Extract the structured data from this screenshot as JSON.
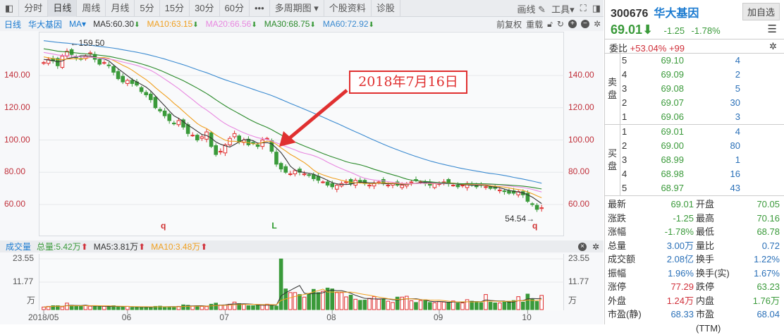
{
  "toolbar": {
    "tabs": [
      "分时",
      "日线",
      "周线",
      "月线",
      "5分",
      "15分",
      "30分",
      "60分",
      "•••",
      "多周期图 ▾",
      "个股资料",
      "诊股"
    ],
    "active": 1,
    "draw": "画线",
    "tools": "工具▾"
  },
  "mabar": {
    "period": "日线",
    "name": "华大基因",
    "ma": "MA▾",
    "ma5": "MA5:60.30",
    "ma10": "MA10:63.15",
    "ma20": "MA20:66.56",
    "ma30": "MA30:68.75",
    "ma60": "MA60:72.92",
    "down": "⬇",
    "adjust": "前复权",
    "reload": "重载"
  },
  "colors": {
    "up": "#e03030",
    "down": "#3a9a3a",
    "ma5": "#333333",
    "ma10": "#f0a020",
    "ma20": "#e888e0",
    "ma30": "#2a8a2a",
    "ma60": "#3a8ad0"
  },
  "volhdr": {
    "label": "成交量",
    "total": "总量:5.42万",
    "ma5": "MA5:3.81万",
    "ma10": "MA10:3.48万",
    "up": "⬆"
  },
  "annotation": {
    "text": "2018年7月16日"
  },
  "markers": [
    {
      "text": "q",
      "index": 25
    },
    {
      "text": "L",
      "index": 49
    },
    {
      "text": "q",
      "index": 105
    }
  ],
  "chart_data": {
    "type": "candlestick",
    "price_ticks": [
      60,
      80,
      100,
      120,
      140
    ],
    "price_range": [
      48,
      170
    ],
    "price_tick_labels": [
      "60.00",
      "80.00",
      "100.00",
      "120.00",
      "140.00"
    ],
    "high_label": "←159.50",
    "high_index": 6,
    "high_value": 159.5,
    "low_label": "54.54→",
    "low_index": 107,
    "low_value": 54.54,
    "vol_ticks": [
      "23.55",
      "11.77",
      "万"
    ],
    "vol_max": 23.55,
    "x_labels": [
      {
        "text": "2018/05",
        "index": 0
      },
      {
        "text": "06",
        "index": 18
      },
      {
        "text": "07",
        "index": 39
      },
      {
        "text": "08",
        "index": 62
      },
      {
        "text": "09",
        "index": 85
      },
      {
        "text": "10",
        "index": 104
      }
    ],
    "history_closes": [
      170,
      169,
      171,
      168,
      167,
      169,
      170,
      168,
      166,
      167,
      168,
      169,
      170,
      168,
      167,
      165,
      166,
      168,
      167,
      166,
      165,
      164,
      166,
      167,
      165,
      164,
      163,
      165,
      164,
      163,
      162,
      163,
      164,
      162,
      161,
      160,
      162,
      161,
      160,
      159,
      158,
      160,
      159,
      158,
      157,
      158,
      157,
      156,
      157,
      155,
      154,
      155,
      154,
      153,
      152,
      151,
      152,
      151,
      150,
      149
    ],
    "closes": [
      148,
      150,
      149,
      146,
      152,
      155,
      153,
      151,
      150,
      152,
      154,
      150,
      147,
      148,
      146,
      142,
      138,
      136,
      137,
      135,
      134,
      130,
      128,
      125,
      120,
      118,
      115,
      112,
      110,
      112,
      108,
      104,
      103,
      100,
      102,
      105,
      96,
      91,
      93,
      97,
      101,
      104,
      99,
      100,
      97,
      98,
      96,
      100,
      101,
      93,
      85,
      82,
      80,
      79,
      81,
      80,
      79,
      78,
      76,
      75,
      74,
      72,
      71,
      72,
      73,
      74,
      73,
      75,
      74,
      73,
      72,
      73,
      74,
      73,
      72,
      73,
      72,
      72,
      73,
      74,
      75,
      74,
      73,
      72,
      73,
      73,
      74,
      73,
      72,
      71,
      72,
      73,
      72,
      71,
      72,
      71,
      70,
      70,
      69,
      68,
      67,
      67,
      68,
      66,
      62,
      60,
      57,
      58
    ],
    "volumes": [
      1.2,
      1.5,
      1.8,
      1.8,
      1.3,
      3.0,
      2.0,
      1.5,
      1.7,
      2.0,
      1.6,
      1.6,
      1.3,
      1.5,
      1.4,
      1.8,
      1.4,
      1.2,
      1.5,
      1.0,
      1.2,
      1.2,
      1.1,
      1.3,
      1.5,
      1.6,
      1.3,
      1.3,
      1.3,
      1.5,
      2.2,
      2.0,
      1.6,
      1.7,
      1.5,
      1.4,
      2.5,
      3.0,
      2.1,
      2.1,
      2.5,
      3.5,
      2.8,
      2.5,
      1.8,
      1.8,
      2.0,
      2.1,
      2.5,
      2.0,
      1.6,
      23.5,
      9.6,
      7.9,
      7.9,
      7.0,
      5.8,
      7.5,
      9.4,
      7.9,
      8.5,
      10.0,
      9.6,
      7.9,
      7.9,
      5.9,
      6.7,
      4.8,
      4.3,
      4.4,
      5.2,
      6.0,
      4.8,
      4.8,
      3.9,
      3.3,
      5.8,
      5.8,
      6.2,
      4.1,
      3.3,
      4.2,
      4.5,
      3.3,
      3.2,
      3.7,
      3.5,
      3.2,
      4.0,
      3.1,
      3.1,
      4.6,
      3.9,
      3.7,
      3.2,
      7.0,
      3.4,
      3.1,
      3.1,
      3.5,
      3.8,
      4.2,
      6.0,
      3.5,
      7.2,
      4.8,
      3.8,
      6.6
    ]
  },
  "quote": {
    "code": "300676",
    "name": "华大基因",
    "add": "加自选",
    "last": "69.01",
    "arrow": "⬇",
    "chg": "-1.25",
    "pct": "-1.78%",
    "menu": "☰"
  },
  "weibi": {
    "label": "委比",
    "pct": "+53.04%",
    "diff": "+99"
  },
  "sell": {
    "label1": "卖",
    "label2": "盘",
    "rows": [
      {
        "l": "5",
        "p": "69.10",
        "v": "4"
      },
      {
        "l": "4",
        "p": "69.09",
        "v": "2"
      },
      {
        "l": "3",
        "p": "69.08",
        "v": "5"
      },
      {
        "l": "2",
        "p": "69.07",
        "v": "30"
      },
      {
        "l": "1",
        "p": "69.06",
        "v": "3"
      }
    ]
  },
  "buy": {
    "label1": "买",
    "label2": "盘",
    "rows": [
      {
        "l": "1",
        "p": "69.01",
        "v": "4"
      },
      {
        "l": "2",
        "p": "69.00",
        "v": "80"
      },
      {
        "l": "3",
        "p": "68.99",
        "v": "1"
      },
      {
        "l": "4",
        "p": "68.98",
        "v": "16"
      },
      {
        "l": "5",
        "p": "68.97",
        "v": "43"
      }
    ]
  },
  "stats": [
    {
      "k": "最新",
      "v": "69.01",
      "c": "g",
      "k2": "开盘",
      "v2": "70.05",
      "c2": "g"
    },
    {
      "k": "涨跌",
      "v": "-1.25",
      "c": "g",
      "k2": "最高",
      "v2": "70.16",
      "c2": "g"
    },
    {
      "k": "涨幅",
      "v": "-1.78%",
      "c": "g",
      "k2": "最低",
      "v2": "68.78",
      "c2": "g"
    },
    {
      "k": "总量",
      "v": "3.00万",
      "c": "b",
      "k2": "量比",
      "v2": "0.72",
      "c2": "b"
    },
    {
      "k": "成交额",
      "v": "2.08亿",
      "c": "b",
      "k2": "换手",
      "v2": "1.22%",
      "c2": "b"
    },
    {
      "k": "振幅",
      "v": "1.96%",
      "c": "b",
      "k2": "换手(实)",
      "v2": "1.67%",
      "c2": "b"
    },
    {
      "k": "涨停",
      "v": "77.29",
      "c": "r",
      "k2": "跌停",
      "v2": "63.23",
      "c2": "g"
    },
    {
      "k": "外盘",
      "v": "1.24万",
      "c": "r",
      "k2": "内盘",
      "v2": "1.76万",
      "c2": "g"
    },
    {
      "k": "市盈(静)",
      "v": "68.33",
      "c": "b",
      "k2": "市盈(TTM)",
      "v2": "68.04",
      "c2": "b"
    }
  ]
}
